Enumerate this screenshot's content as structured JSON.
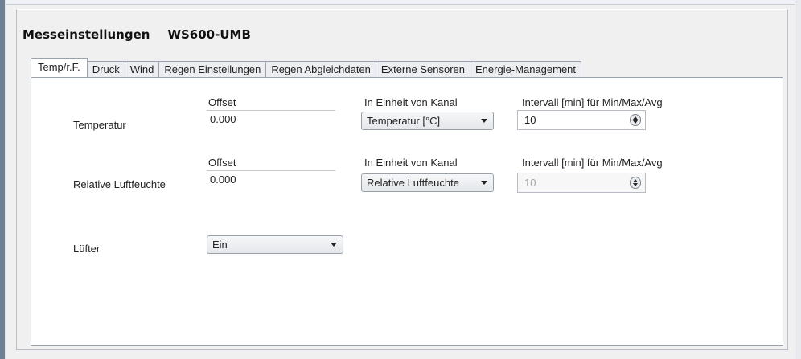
{
  "header": {
    "title": "Messeinstellungen",
    "device": "WS600-UMB"
  },
  "tabs": [
    {
      "label": "Temp/r.F."
    },
    {
      "label": "Druck"
    },
    {
      "label": "Wind"
    },
    {
      "label": "Regen Einstellungen"
    },
    {
      "label": "Regen Abgleichdaten"
    },
    {
      "label": "Externe Sensoren"
    },
    {
      "label": "Energie-Management"
    }
  ],
  "active_tab": "Temp/r.F.",
  "rows": {
    "temperatur": {
      "label": "Temperatur",
      "offset_head": "Offset",
      "offset_value": "0.000",
      "unit_head": "In Einheit von Kanal",
      "unit_value": "Temperatur [°C]",
      "interval_head": "Intervall [min] für Min/Max/Avg",
      "interval_value": "10"
    },
    "luftfeuchte": {
      "label": "Relative Luftfeuchte",
      "offset_head": "Offset",
      "offset_value": "0.000",
      "unit_head": "In Einheit von Kanal",
      "unit_value": "Relative Luftfeuchte",
      "interval_head": "Intervall [min] für Min/Max/Avg",
      "interval_value": "10"
    },
    "luefter": {
      "label": "Lüfter",
      "value": "Ein"
    }
  },
  "colors": {
    "window_bg": "#f0f0f0",
    "content_bg": "#ffffff",
    "border": "#9aa3ad",
    "disabled_text": "#a6a6a6"
  }
}
